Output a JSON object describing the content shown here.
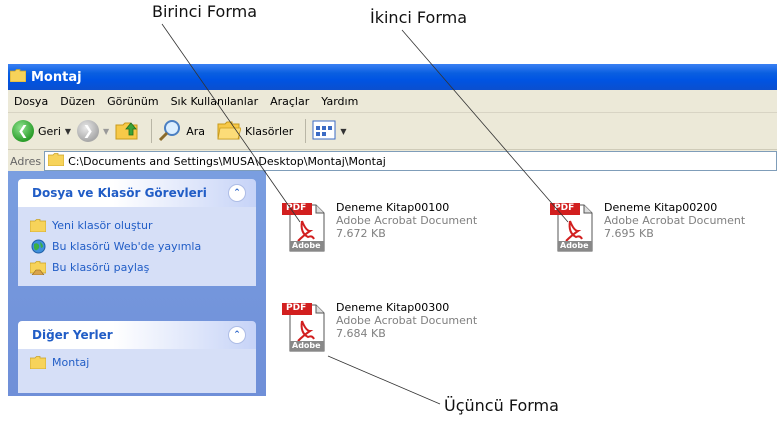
{
  "annotations": {
    "first_form": "Birinci Forma",
    "second_form": "İkinci Forma",
    "third_form": "Üçüncü Forma"
  },
  "window": {
    "title": "Montaj"
  },
  "menu": [
    "Dosya",
    "Düzen",
    "Görünüm",
    "Sık Kullanılanlar",
    "Araçlar",
    "Yardım"
  ],
  "toolbar": {
    "back_label": "Geri",
    "search_label": "Ara",
    "folders_label": "Klasörler"
  },
  "address": {
    "label": "Adres",
    "path": "C:\\Documents and Settings\\MUSA\\Desktop\\Montaj\\Montaj"
  },
  "tasks_panel": {
    "title": "Dosya ve Klasör Görevleri",
    "items": [
      "Yeni klasör oluştur",
      "Bu klasörü Web'de yayımla",
      "Bu klasörü paylaş"
    ]
  },
  "other_places": {
    "title": "Diğer Yerler",
    "partial_item": "Montaj"
  },
  "files": [
    {
      "name": "Deneme Kitap00100",
      "type": "Adobe Acrobat Document",
      "size": "7.672 KB"
    },
    {
      "name": "Deneme Kitap00200",
      "type": "Adobe Acrobat Document",
      "size": "7.695 KB"
    },
    {
      "name": "Deneme Kitap00300",
      "type": "Adobe Acrobat Document",
      "size": "7.684 KB"
    }
  ],
  "pdf_badge": "PDF",
  "adobe_badge": "Adobe",
  "colors": {
    "titlebar": "#0054e3",
    "leftpane": "#7a9ee0",
    "task_link": "#215dc6",
    "pdf_red": "#d21f1f"
  }
}
